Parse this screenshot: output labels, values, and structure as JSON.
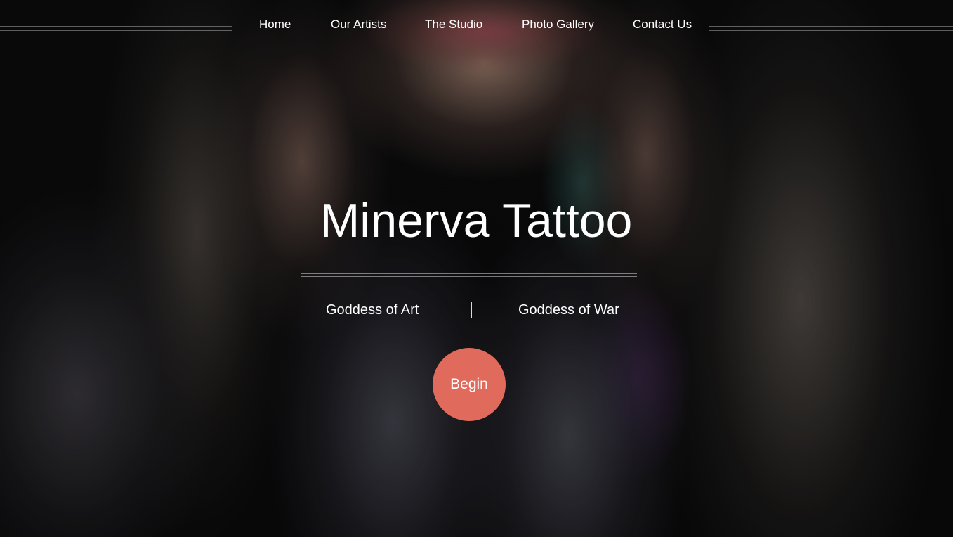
{
  "nav": {
    "items": [
      {
        "label": "Home"
      },
      {
        "label": "Our Artists"
      },
      {
        "label": "The Studio"
      },
      {
        "label": "Photo Gallery"
      },
      {
        "label": "Contact Us"
      }
    ]
  },
  "hero": {
    "title": "Minerva Tattoo",
    "tagline_left": "Goddess of Art",
    "tagline_separator": "||",
    "tagline_right": "Goddess of War",
    "cta_label": "Begin"
  },
  "colors": {
    "cta_background": "#e06b5c",
    "text": "#ffffff",
    "background": "#0a0a0b"
  },
  "background_image": "photo-of-tattooed-woman"
}
